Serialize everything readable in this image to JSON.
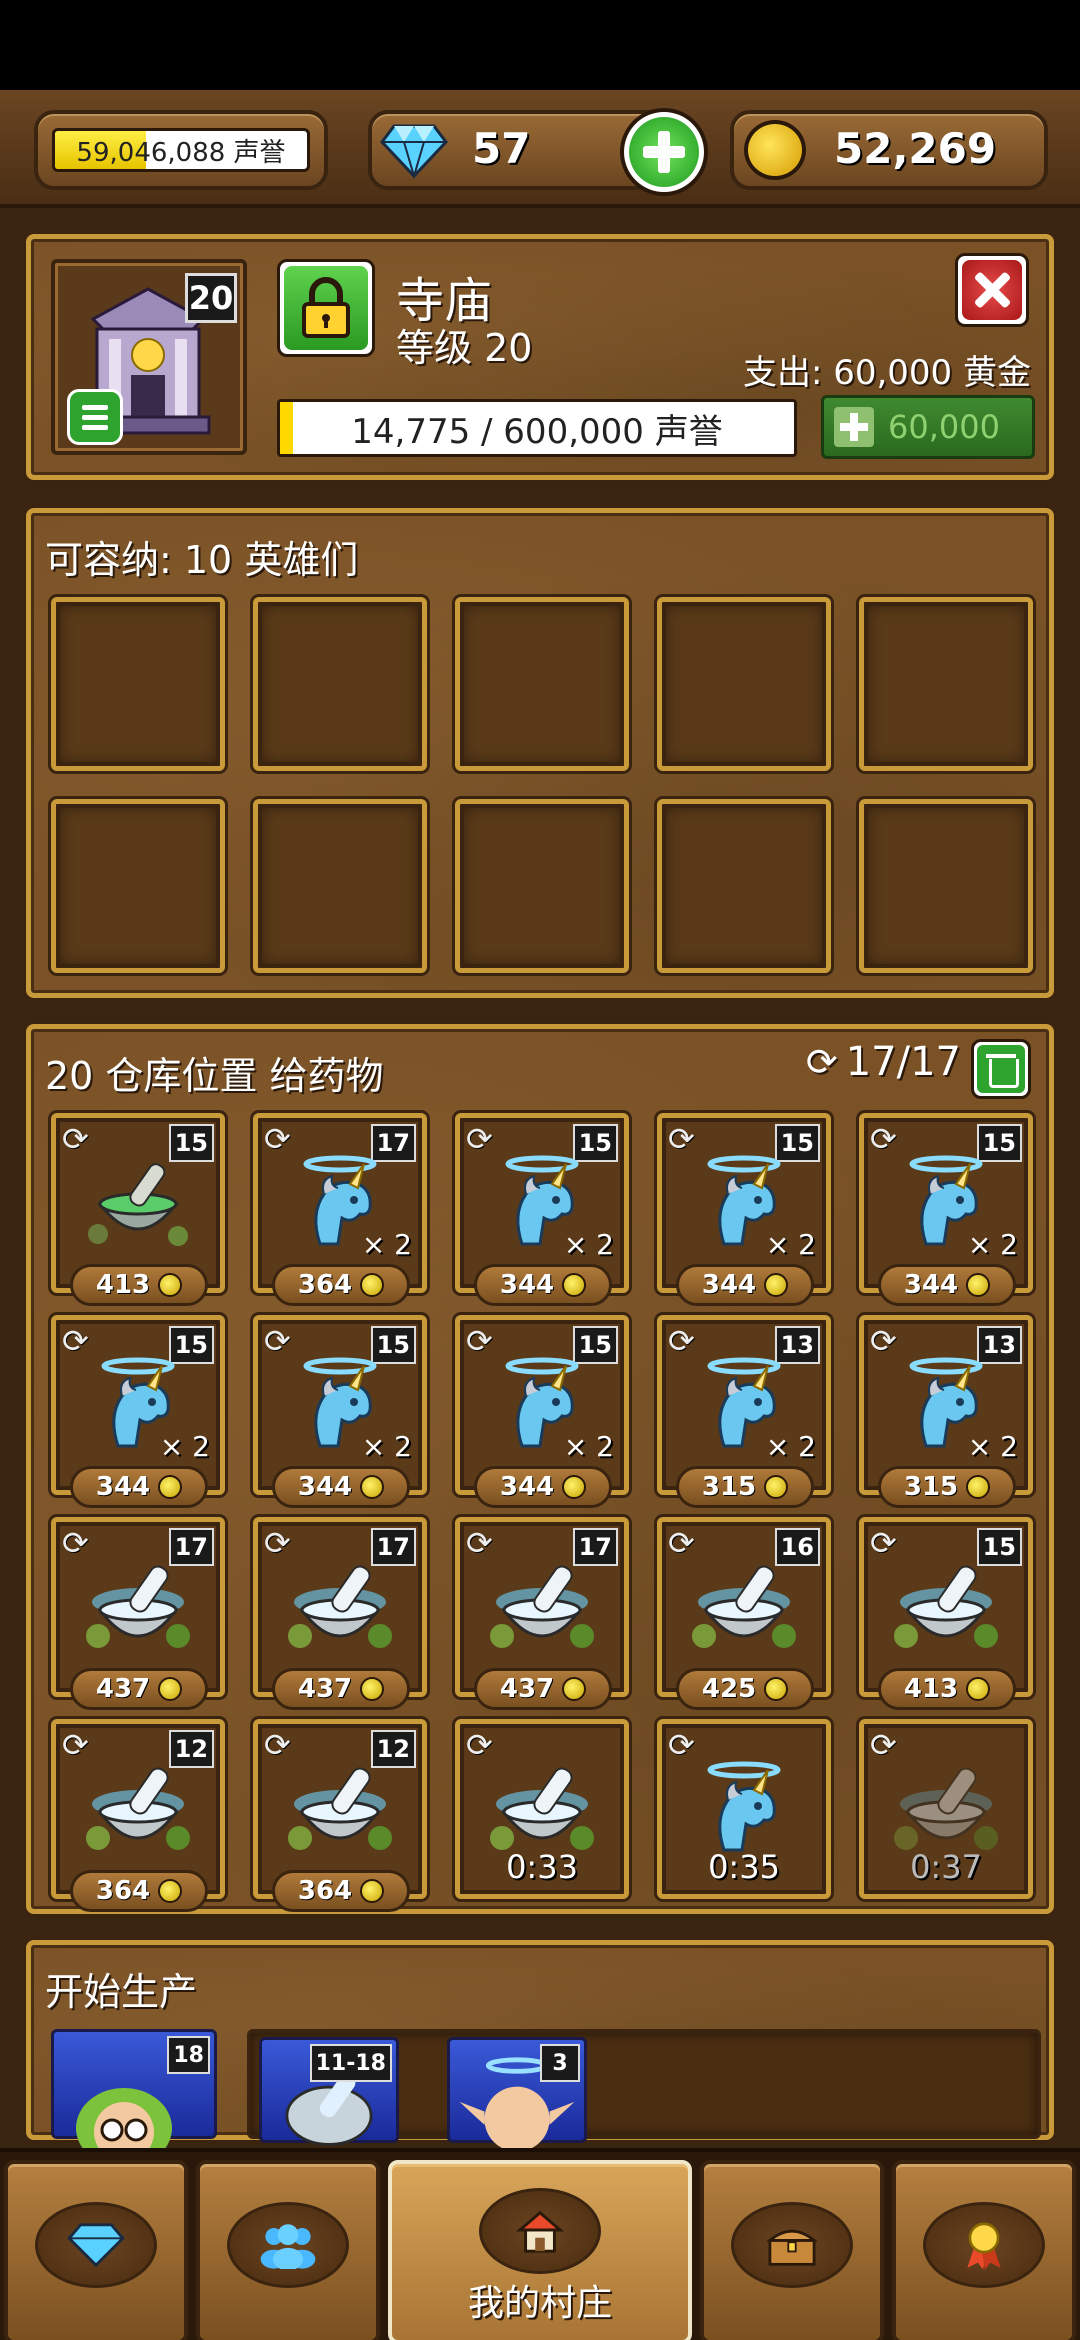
{
  "topbar": {
    "reputation_text": "59,046,088 声誉",
    "reputation_progress": 0.36,
    "gems": "57",
    "gold": "52,269"
  },
  "building": {
    "name": "寺庙",
    "level_badge": "20",
    "level_text": "等级 20",
    "cost_text": "支出: 60,000 黄金",
    "progress_text": "14,775 / 600,000 声誉",
    "progress": 0.025,
    "buy_label": "60,000"
  },
  "heroes": {
    "title": "可容纳: 10 英雄们",
    "slots": 10
  },
  "storage": {
    "title": "20 仓库位置 给药物",
    "count": "17/17",
    "items": [
      {
        "icon": "green-mortar-icon",
        "qty": "15",
        "price": "413",
        "mult": "",
        "timer": ""
      },
      {
        "icon": "unicorn-icon",
        "qty": "17",
        "price": "364",
        "mult": "× 2",
        "timer": ""
      },
      {
        "icon": "unicorn-icon",
        "qty": "15",
        "price": "344",
        "mult": "× 2",
        "timer": ""
      },
      {
        "icon": "unicorn-icon",
        "qty": "15",
        "price": "344",
        "mult": "× 2",
        "timer": ""
      },
      {
        "icon": "unicorn-icon",
        "qty": "15",
        "price": "344",
        "mult": "× 2",
        "timer": ""
      },
      {
        "icon": "unicorn-icon",
        "qty": "15",
        "price": "344",
        "mult": "× 2",
        "timer": ""
      },
      {
        "icon": "unicorn-icon",
        "qty": "15",
        "price": "344",
        "mult": "× 2",
        "timer": ""
      },
      {
        "icon": "unicorn-icon",
        "qty": "15",
        "price": "344",
        "mult": "× 2",
        "timer": ""
      },
      {
        "icon": "unicorn-icon",
        "qty": "13",
        "price": "315",
        "mult": "× 2",
        "timer": ""
      },
      {
        "icon": "unicorn-icon",
        "qty": "13",
        "price": "315",
        "mult": "× 2",
        "timer": ""
      },
      {
        "icon": "blue-mortar-icon",
        "qty": "17",
        "price": "437",
        "mult": "",
        "timer": ""
      },
      {
        "icon": "blue-mortar-icon",
        "qty": "17",
        "price": "437",
        "mult": "",
        "timer": ""
      },
      {
        "icon": "blue-mortar-icon",
        "qty": "17",
        "price": "437",
        "mult": "",
        "timer": ""
      },
      {
        "icon": "blue-mortar-icon",
        "qty": "16",
        "price": "425",
        "mult": "",
        "timer": ""
      },
      {
        "icon": "blue-mortar-icon",
        "qty": "15",
        "price": "413",
        "mult": "",
        "timer": ""
      },
      {
        "icon": "blue-mortar-icon",
        "qty": "12",
        "price": "364",
        "mult": "",
        "timer": ""
      },
      {
        "icon": "blue-mortar-icon",
        "qty": "12",
        "price": "364",
        "mult": "",
        "timer": ""
      },
      {
        "icon": "blue-mortar-icon",
        "qty": "",
        "price": "",
        "mult": "",
        "timer": "0:33"
      },
      {
        "icon": "unicorn-icon",
        "qty": "",
        "price": "",
        "mult": "",
        "timer": "0:35"
      },
      {
        "icon": "blue-mortar-icon",
        "qty": "",
        "price": "",
        "mult": "",
        "timer": "0:37",
        "faded": true
      }
    ]
  },
  "production": {
    "title": "开始生产",
    "chef_badge": "18",
    "queue": [
      {
        "badge": "11-18",
        "icon": "blue-mortar-icon"
      },
      {
        "badge": "3",
        "icon": "monk-icon"
      }
    ]
  },
  "nav": {
    "village_label": "我的村庄"
  }
}
